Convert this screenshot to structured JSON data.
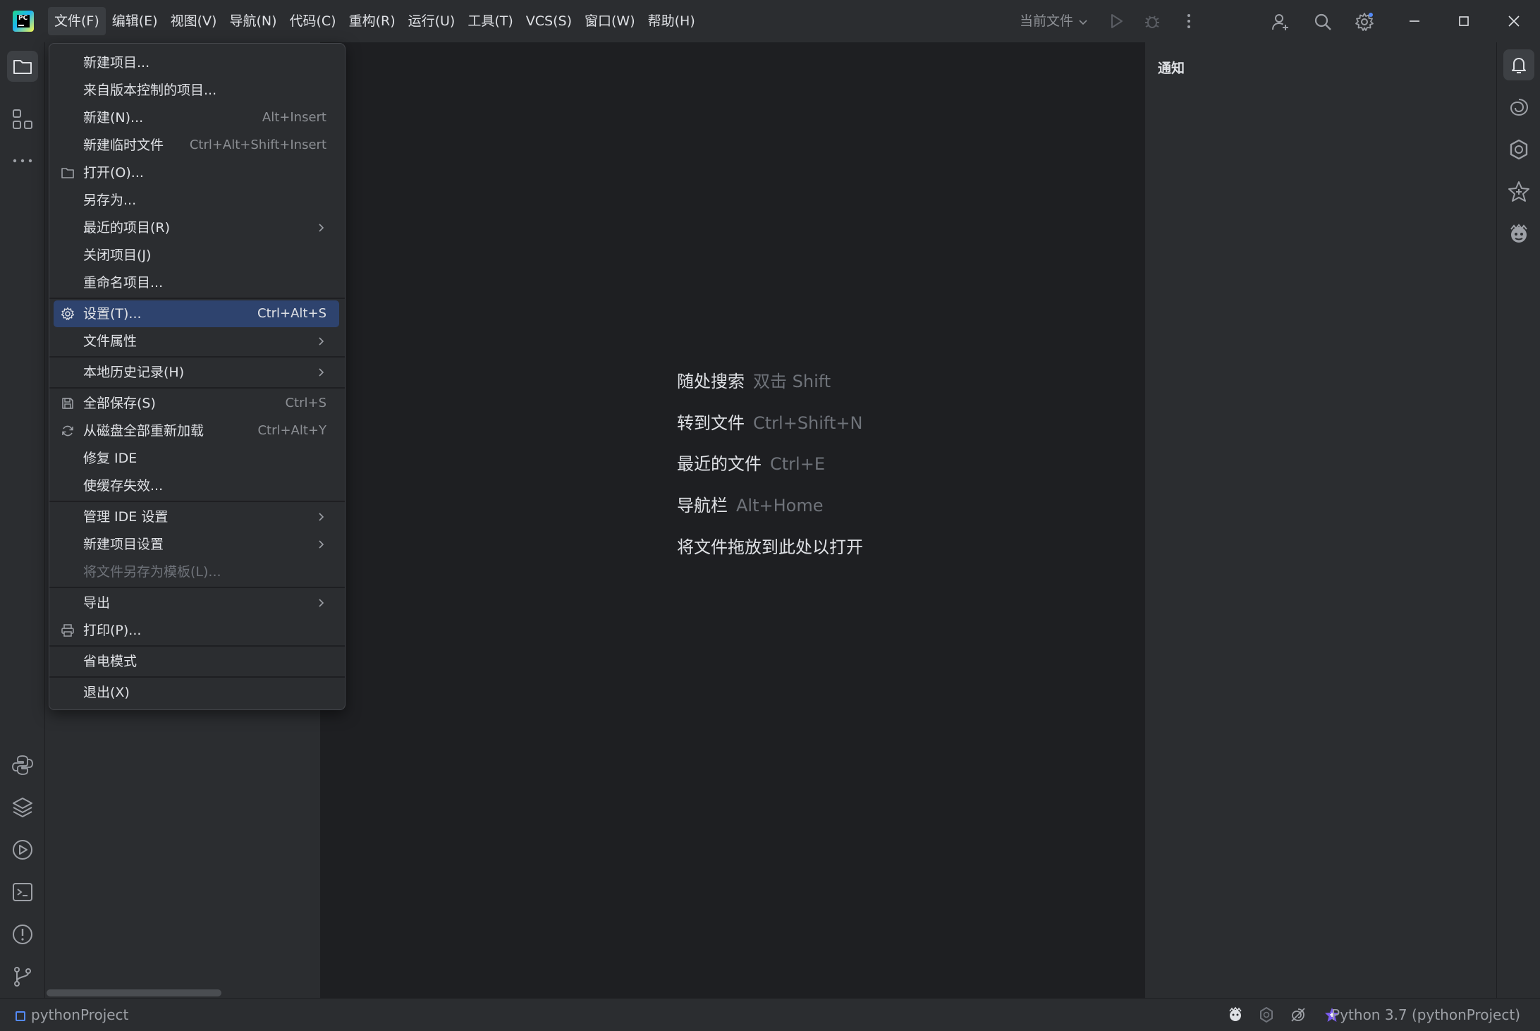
{
  "menubar": {
    "items": [
      "文件(F)",
      "编辑(E)",
      "视图(V)",
      "导航(N)",
      "代码(C)",
      "重构(R)",
      "运行(U)",
      "工具(T)",
      "VCS(S)",
      "窗口(W)",
      "帮助(H)"
    ]
  },
  "toolbar": {
    "current_file": "当前文件"
  },
  "file_menu": {
    "items": [
      {
        "label": "新建项目...",
        "shortcut": "",
        "icon": "",
        "submenu": false
      },
      {
        "label": "来自版本控制的项目...",
        "shortcut": "",
        "icon": "",
        "submenu": false
      },
      {
        "label": "新建(N)...",
        "shortcut": "Alt+Insert",
        "icon": "",
        "submenu": false
      },
      {
        "label": "新建临时文件",
        "shortcut": "Ctrl+Alt+Shift+Insert",
        "icon": "",
        "submenu": false
      },
      {
        "label": "打开(O)...",
        "shortcut": "",
        "icon": "folder-icon",
        "submenu": false
      },
      {
        "label": "另存为...",
        "shortcut": "",
        "icon": "",
        "submenu": false
      },
      {
        "label": "最近的项目(R)",
        "shortcut": "",
        "icon": "",
        "submenu": true
      },
      {
        "label": "关闭项目(J)",
        "shortcut": "",
        "icon": "",
        "submenu": false
      },
      {
        "label": "重命名项目...",
        "shortcut": "",
        "icon": "",
        "submenu": false
      },
      {
        "label": "设置(T)...",
        "shortcut": "Ctrl+Alt+S",
        "icon": "gear-icon",
        "submenu": false,
        "highlighted": true
      },
      {
        "label": "文件属性",
        "shortcut": "",
        "icon": "",
        "submenu": true
      },
      {
        "label": "本地历史记录(H)",
        "shortcut": "",
        "icon": "",
        "submenu": true
      },
      {
        "label": "全部保存(S)",
        "shortcut": "Ctrl+S",
        "icon": "save-icon",
        "submenu": false
      },
      {
        "label": "从磁盘全部重新加载",
        "shortcut": "Ctrl+Alt+Y",
        "icon": "reload-icon",
        "submenu": false
      },
      {
        "label": "修复 IDE",
        "shortcut": "",
        "icon": "",
        "submenu": false
      },
      {
        "label": "使缓存失效...",
        "shortcut": "",
        "icon": "",
        "submenu": false
      },
      {
        "label": "管理 IDE 设置",
        "shortcut": "",
        "icon": "",
        "submenu": true
      },
      {
        "label": "新建项目设置",
        "shortcut": "",
        "icon": "",
        "submenu": true
      },
      {
        "label": "将文件另存为模板(L)...",
        "shortcut": "",
        "icon": "",
        "submenu": false,
        "disabled": true
      },
      {
        "label": "导出",
        "shortcut": "",
        "icon": "",
        "submenu": true
      },
      {
        "label": "打印(P)...",
        "shortcut": "",
        "icon": "print-icon",
        "submenu": false
      },
      {
        "label": "省电模式",
        "shortcut": "",
        "icon": "",
        "submenu": false
      },
      {
        "label": "退出(X)",
        "shortcut": "",
        "icon": "",
        "submenu": false
      }
    ]
  },
  "editor": {
    "hints": [
      {
        "label": "随处搜索",
        "key": "双击 Shift"
      },
      {
        "label": "转到文件",
        "key": "Ctrl+Shift+N"
      },
      {
        "label": "最近的文件",
        "key": "Ctrl+E"
      },
      {
        "label": "导航栏",
        "key": "Alt+Home"
      },
      {
        "label": "将文件拖放到此处以打开",
        "key": ""
      }
    ]
  },
  "notifications": {
    "title": "通知"
  },
  "statusbar": {
    "project": "pythonProject",
    "interpreter": "Python 3.7 (pythonProject)"
  },
  "colors": {
    "menu_highlight": "#2e436e",
    "panel_bg": "#2b2d30",
    "editor_bg": "#1e1f22",
    "accent": "#548af7"
  }
}
